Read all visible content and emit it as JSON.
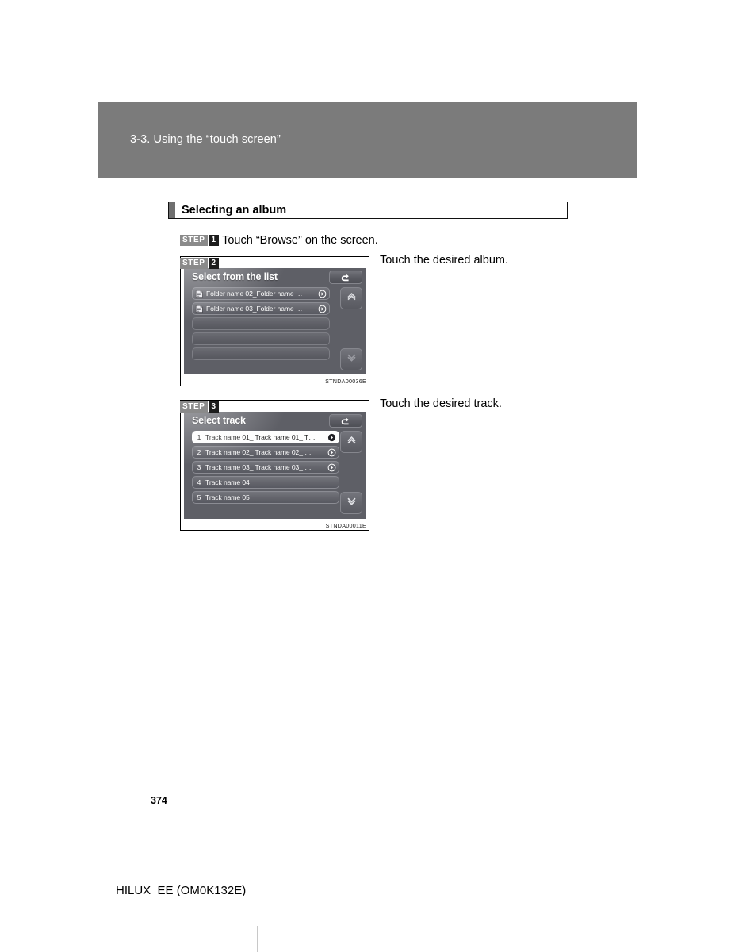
{
  "header": {
    "title": "3-3. Using the “touch screen”"
  },
  "section": {
    "heading": "Selecting an album"
  },
  "steps": {
    "step_word": "STEP",
    "step1": {
      "number": "1",
      "text": "Touch “Browse” on the screen."
    },
    "step2": {
      "number": "2",
      "caption": "Touch the desired album.",
      "figure_code": "STNDA00036E",
      "screen": {
        "title": "Select from the list",
        "return_icon": "return-arrow-icon",
        "scroll_up_icon": "chevron-up-icon",
        "scroll_down_icon": "chevron-down-icon",
        "rows": [
          {
            "icon": "folder-icon",
            "label": "Folder name 02_Folder name …",
            "chevron": "chevron-right-circle-icon",
            "empty": false,
            "selected": false
          },
          {
            "icon": "folder-icon",
            "label": "Folder name 03_Folder name …",
            "chevron": "chevron-right-circle-icon",
            "empty": false,
            "selected": false
          },
          {
            "icon": "",
            "label": "",
            "chevron": "",
            "empty": true,
            "selected": false
          },
          {
            "icon": "",
            "label": "",
            "chevron": "",
            "empty": true,
            "selected": false
          },
          {
            "icon": "",
            "label": "",
            "chevron": "",
            "empty": true,
            "selected": false
          }
        ]
      }
    },
    "step3": {
      "number": "3",
      "caption": "Touch the desired track.",
      "figure_code": "STNDA00011E",
      "screen": {
        "title": "Select track",
        "return_icon": "return-arrow-icon",
        "scroll_up_icon": "chevron-up-icon",
        "scroll_down_icon": "chevron-down-icon",
        "rows": [
          {
            "index": "1",
            "label": "Track name 01_ Track name 01_ T…",
            "chevron": "chevron-right-circle-icon",
            "selected": true
          },
          {
            "index": "2",
            "label": "Track name 02_ Track name 02_ …",
            "chevron": "chevron-right-circle-icon",
            "selected": false
          },
          {
            "index": "3",
            "label": "Track name 03_ Track name 03_ …",
            "chevron": "chevron-right-circle-icon",
            "selected": false
          },
          {
            "index": "4",
            "label": "Track name 04",
            "chevron": "",
            "selected": false
          },
          {
            "index": "5",
            "label": "Track name 05",
            "chevron": "",
            "selected": false
          }
        ]
      }
    }
  },
  "footer": {
    "page_number": "374",
    "document_id": "HILUX_EE (OM0K132E)"
  },
  "colors": {
    "header_band": "#7b7b7b",
    "screen_background": "#5e5f66",
    "step_chip": "#8a8a8a",
    "step_number_chip": "#1d1d1d",
    "selected_row": "#fdfdfd"
  }
}
